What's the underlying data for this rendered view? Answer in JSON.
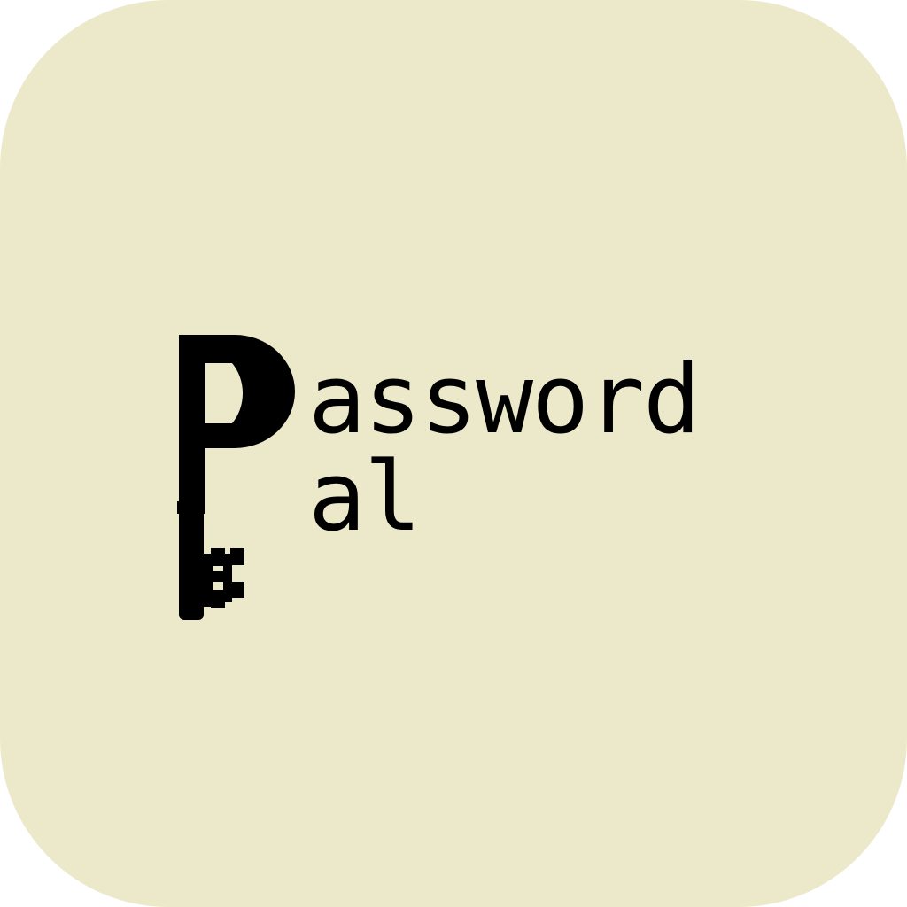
{
  "app_icon": {
    "background_color": "#ECE9CB",
    "ink_color": "#000000",
    "logo": {
      "mark_icon": "key-letter-p-icon",
      "line1_text": "assword",
      "line2_text": "al"
    }
  }
}
